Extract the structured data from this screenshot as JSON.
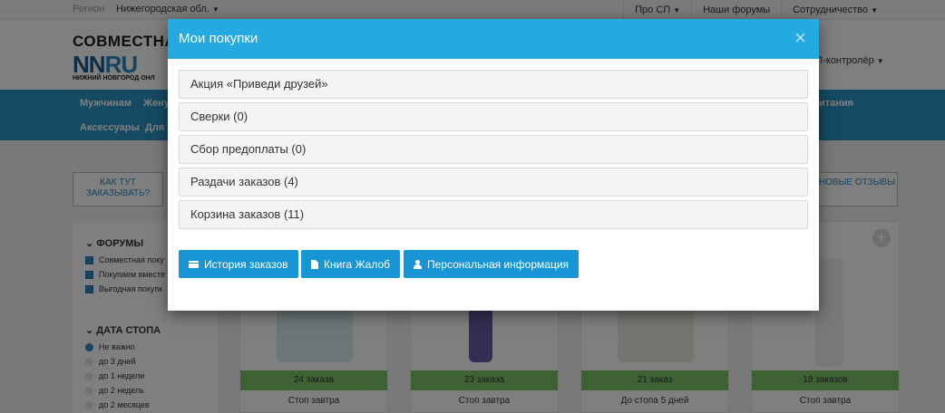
{
  "topbar": {
    "region_label": "Регион",
    "region_value": "Нижегородская обл.",
    "nav": [
      "Про СП",
      "Наши форумы",
      "Сотрудничество"
    ]
  },
  "header": {
    "logo_title": "СОВМЕСТНАЯ",
    "logo_nn": "NN",
    "logo_ru": "RU",
    "logo_sub": "НИЖНИЙ НОВГОРОД ОНЛ",
    "controller": "Л-контролёр"
  },
  "mainnav": {
    "row1": [
      "Мужчинам",
      "Жену",
      "итания"
    ],
    "row2": [
      "Аксессуары",
      "Для"
    ]
  },
  "promo": {
    "left": "КАК ТУТ ЗАКАЗЫВАТЬ?",
    "right": "НОВЫЕ ОТЗЫВЫ"
  },
  "sidebar": {
    "forums_title": "ФОРУМЫ",
    "forums": [
      "Совместная поку",
      "Покупаем вместе",
      "Выгодная покупк"
    ],
    "stop_title": "ДАТА СТОПА",
    "stop_options": [
      "Не важно",
      "до 3 дней",
      "до 1 недели",
      "до 2 недель",
      "до 2 месяцев"
    ]
  },
  "cards": [
    {
      "orders": "24 заказа",
      "stop": "Стоп завтра"
    },
    {
      "orders": "23 заказа",
      "stop": "Стоп завтра"
    },
    {
      "orders": "21 заказ",
      "stop": "До стопа 5 дней"
    },
    {
      "orders": "18 заказов",
      "stop": "Стоп завтра"
    }
  ],
  "modal": {
    "title": "Мои покупки",
    "close": "×",
    "sections": [
      "Акция «Приведи друзей»",
      "Сверки (0)",
      "Сбор предоплаты (0)",
      "Раздачи заказов (4)",
      "Корзина заказов (11)"
    ],
    "buttons": {
      "history": "История заказов",
      "complaints": "Книга Жалоб",
      "personal": "Персональная информация"
    }
  },
  "colors": {
    "modal_header": "#24a9e1",
    "button": "#1795d5",
    "nav": "#2b95c4",
    "badge": "#7ec56b"
  }
}
